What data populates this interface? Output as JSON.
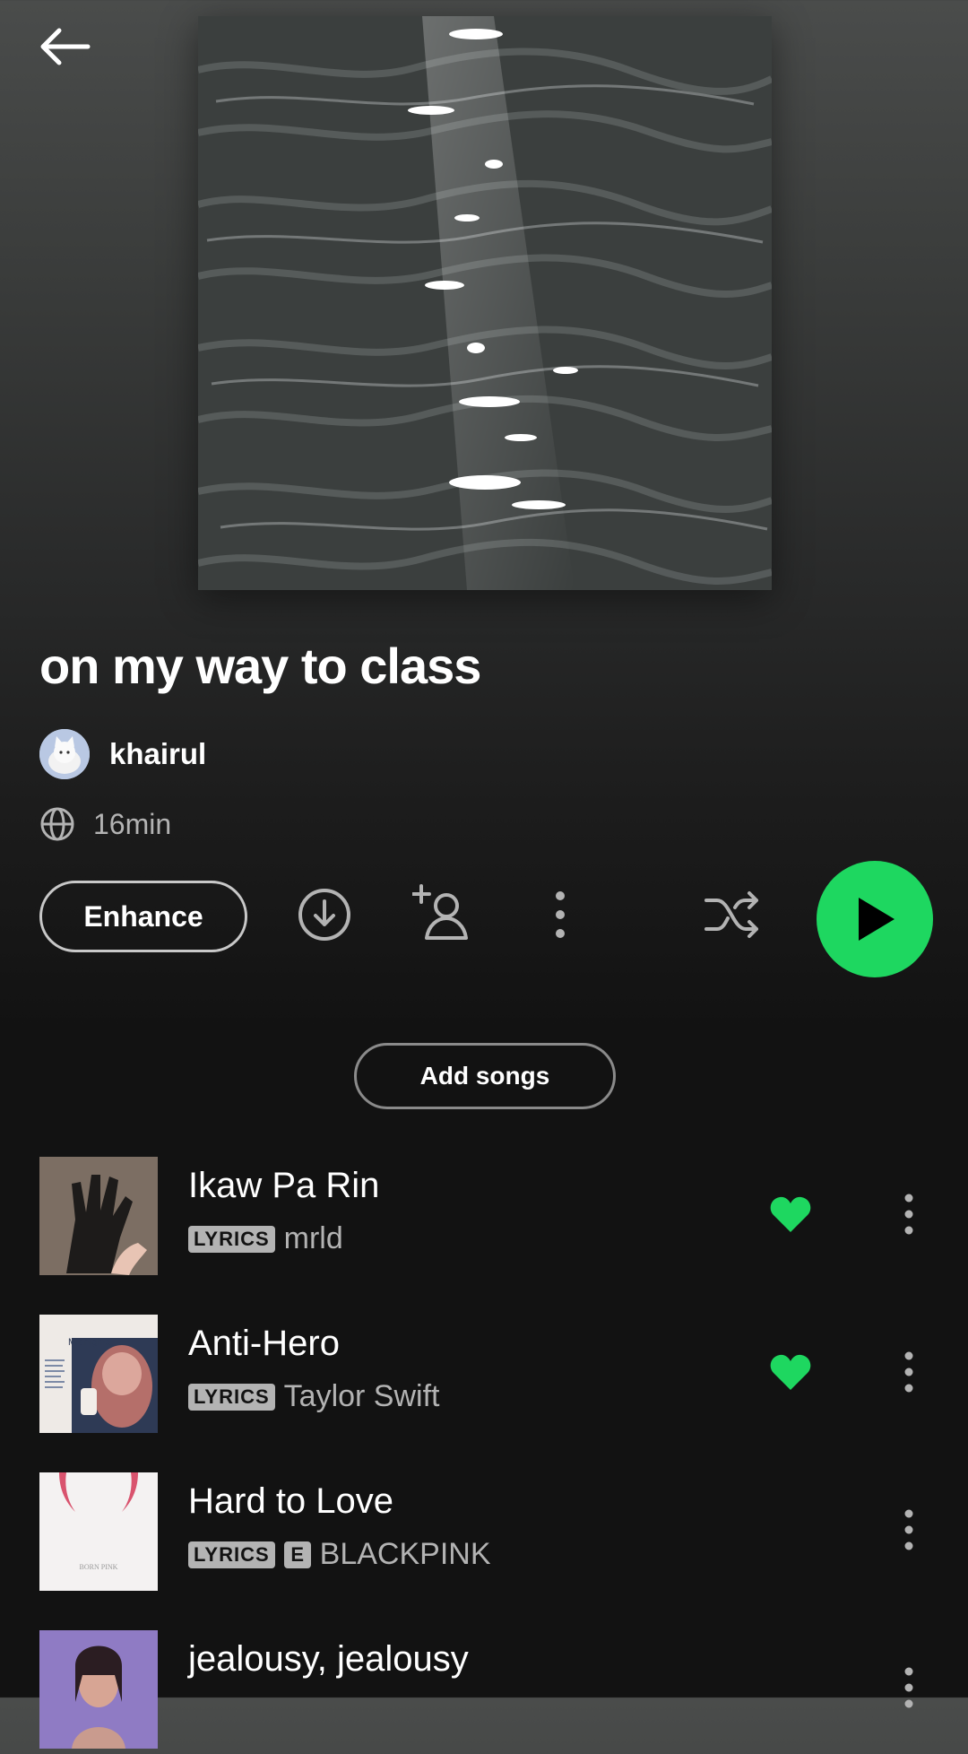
{
  "header": {
    "back_icon": "arrow-left-icon"
  },
  "playlist": {
    "title": "on my way to class",
    "owner": "khairul",
    "duration": "16min",
    "visibility_icon": "globe-icon"
  },
  "actions": {
    "enhance_label": "Enhance",
    "download_icon": "download-circle-icon",
    "add_collaborator_icon": "add-user-icon",
    "more_icon": "more-vertical-icon",
    "shuffle_icon": "shuffle-icon",
    "play_icon": "play-icon"
  },
  "add_songs_label": "Add songs",
  "tracks": [
    {
      "title": "Ikaw Pa Rin",
      "badge": "LYRICS",
      "explicit": "",
      "artist": "mrld",
      "liked": true
    },
    {
      "title": "Anti-Hero",
      "badge": "LYRICS",
      "explicit": "",
      "artist": "Taylor Swift",
      "liked": true,
      "cover_text": "Midnights"
    },
    {
      "title": "Hard to Love",
      "badge": "LYRICS",
      "explicit": "E",
      "artist": "BLACKPINK",
      "liked": false,
      "cover_text": "BORN PINK"
    },
    {
      "title": "jealousy, jealousy",
      "badge": "",
      "explicit": "",
      "artist": "",
      "liked": false
    }
  ],
  "colors": {
    "accent": "#1ed760",
    "text_secondary": "#b3b3b3",
    "background": "#121212"
  }
}
